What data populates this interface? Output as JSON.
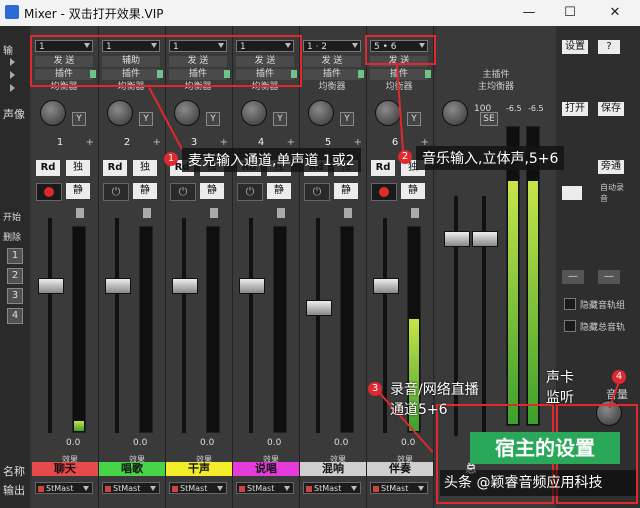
{
  "window": {
    "title": "Mixer - 双击打开效果.VIP",
    "min": "—",
    "max": "☐",
    "close": "✕"
  },
  "left_labels": {
    "input_top": "输",
    "pan": "声像",
    "start": "开始",
    "delete": "删除",
    "name": "名称",
    "output": "输出",
    "nums": [
      "1",
      "2",
      "3",
      "4"
    ]
  },
  "channels": [
    {
      "num": "1",
      "input": "1",
      "send": "发 送",
      "insert": "插件",
      "eq": "均衡器",
      "name": "聊天",
      "name_color": "#e64a4a",
      "peak": "0.0",
      "fx": "效果",
      "out": "StMast",
      "rec": true,
      "fader": 0.72,
      "meter": 0.05
    },
    {
      "num": "2",
      "input": "1",
      "send": "辅助",
      "insert": "插件",
      "eq": "均衡器",
      "name": "唱歌",
      "name_color": "#47d448",
      "peak": "0.0",
      "fx": "效果",
      "out": "StMast",
      "rec": false,
      "fader": 0.72,
      "meter": 0
    },
    {
      "num": "3",
      "input": "1",
      "send": "发 送",
      "insert": "插件",
      "eq": "均衡器",
      "name": "干声",
      "name_color": "#f2ec2a",
      "peak": "0.0",
      "fx": "效果",
      "out": "StMast",
      "rec": false,
      "fader": 0.72,
      "meter": 0
    },
    {
      "num": "4",
      "input": "1",
      "send": "发 送",
      "insert": "插件",
      "eq": "均衡器",
      "name": "说唱",
      "name_color": "#e53bd9",
      "peak": "0.0",
      "fx": "效果",
      "out": "StMast",
      "rec": false,
      "fader": 0.72,
      "meter": 0
    },
    {
      "num": "5",
      "input": "1 · 2",
      "send": "发 送",
      "insert": "插件",
      "eq": "均衡器",
      "name": "混响",
      "name_color": "#cfcfcf",
      "peak": "0.0",
      "fx": "效果",
      "out": "StMast",
      "rec": false,
      "fader": 0.62,
      "meter": 0
    },
    {
      "num": "6",
      "input": "5 • 6",
      "send": "发 送",
      "insert": "插件",
      "eq": "均衡器",
      "name": "伴奏",
      "name_color": "#cfcfcf",
      "peak": "0.0",
      "fx": "效果",
      "out": "StMast",
      "rec": true,
      "fader": 0.72,
      "meter": 0.55
    }
  ],
  "master": {
    "main_insert": "主插件",
    "main_eq": "主均衡器",
    "db_l": "-6.5",
    "db_r": "-6.5",
    "pan": "100",
    "se": "SE",
    "name": "总",
    "meter": 0.82
  },
  "right_panel": {
    "settings": "设置",
    "help": "?",
    "open": "打开",
    "save": "保存",
    "bypass": "旁通",
    "auto_rec": "自动录音",
    "hide_rec": "隐藏音轨组",
    "hide_total": "隐藏总音轨",
    "vol": "音量",
    "dash": "—"
  },
  "annotations": [
    {
      "n": "1",
      "text": "麦克输入通道,单声道 1或2"
    },
    {
      "n": "2",
      "text": "音乐输入,立体声,5+6"
    },
    {
      "n": "3",
      "text": "录音/网络直播\n通道5+6"
    },
    {
      "n": "4",
      "text": "声卡\n监听"
    }
  ],
  "watermark": {
    "banner": "宿主的设置",
    "credit": "头条 @颖睿音频应用科技"
  }
}
